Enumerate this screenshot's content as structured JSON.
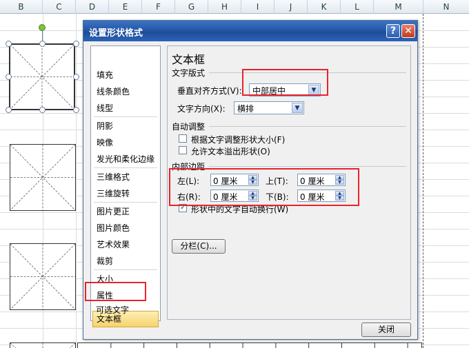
{
  "sheet": {
    "columns": [
      "B",
      "C",
      "D",
      "E",
      "F",
      "G",
      "H",
      "I",
      "J",
      "K",
      "L",
      "M",
      "N"
    ]
  },
  "dialog": {
    "title": "设置形状格式",
    "help_label": "?",
    "close_label": "✕",
    "nav_items": [
      "填充",
      "线条颜色",
      "线型",
      "阴影",
      "映像",
      "发光和柔化边缘",
      "三维格式",
      "三维旋转",
      "图片更正",
      "图片颜色",
      "艺术效果",
      "裁剪",
      "大小",
      "属性",
      "文本框",
      "可选文字"
    ],
    "selected_index": 14,
    "panel": {
      "title": "文本框",
      "layout_section": "文字版式",
      "vertical_align_label": "垂直对齐方式(V):",
      "vertical_align_value": "中部居中",
      "text_direction_label": "文字方向(X):",
      "text_direction_value": "横排",
      "autofit_section": "自动调整",
      "resize_shape_label": "根据文字调整形状大小(F)",
      "overflow_label": "允许文本溢出形状(O)",
      "margins_section": "内部边距",
      "left_label": "左(L):",
      "left_value": "0 厘米",
      "top_label": "上(T):",
      "top_value": "0 厘米",
      "right_label": "右(R):",
      "right_value": "0 厘米",
      "bottom_label": "下(B):",
      "bottom_value": "0 厘米",
      "wrap_label": "形状中的文字自动换行(W)",
      "columns_button": "分栏(C)..."
    },
    "close_button": "关闭"
  }
}
